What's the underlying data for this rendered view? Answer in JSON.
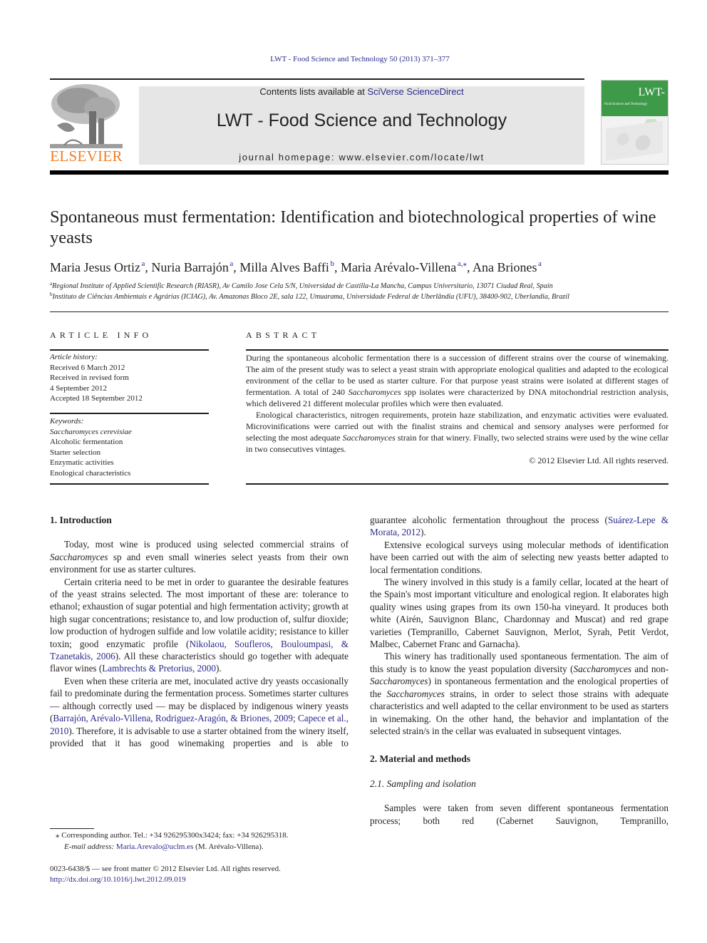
{
  "header": {
    "running_head": "LWT - Food Science and Technology 50 (2013) 371–377",
    "publisher_logo_text": "ELSEVIER",
    "contents_prefix": "Contents lists available at ",
    "contents_link": "SciVerse ScienceDirect",
    "journal_name": "LWT - Food Science and Technology",
    "homepage": "journal homepage: www.elsevier.com/locate/lwt",
    "cover": {
      "title": "LWT-",
      "subtitle": "Food Science and Technology"
    }
  },
  "article": {
    "title": "Spontaneous must fermentation: Identification and biotechnological properties of wine yeasts",
    "authors": [
      {
        "name": "Maria Jesus Ortiz",
        "sup": "a"
      },
      {
        "name": "Nuria Barrajón",
        "sup": "a"
      },
      {
        "name": "Milla Alves Baffi",
        "sup": "b"
      },
      {
        "name": "Maria Arévalo-Villena",
        "sup": "a,⁎"
      },
      {
        "name": "Ana Briones",
        "sup": "a"
      }
    ],
    "affiliations": [
      {
        "sup": "a",
        "text": "Regional Institute of Applied Scientific Research (RIASR), Av Camilo Jose Cela S/N, Universidad de Castilla-La Mancha, Campus Universitario, 13071 Ciudad Real, Spain"
      },
      {
        "sup": "b",
        "text": "Instituto de Ciências Ambientais e Agrárias (ICIAG), Av. Amazonas Bloco 2E, sala 122, Umuarama, Universidade Federal de Uberlândia (UFU), 38400-902, Uberlandia, Brazil"
      }
    ]
  },
  "article_info": {
    "heading": "ARTICLE INFO",
    "history_label": "Article history:",
    "history": [
      "Received 6 March 2012",
      "Received in revised form",
      "4 September 2012",
      "Accepted 18 September 2012"
    ],
    "keywords_label": "Keywords:",
    "keywords": [
      "Saccharomyces cerevisiae",
      "Alcoholic fermentation",
      "Starter selection",
      "Enzymatic activities",
      "Enological characteristics"
    ]
  },
  "abstract": {
    "heading": "ABSTRACT",
    "p1_a": "During the spontaneous alcoholic fermentation there is a succession of different strains over the course of winemaking. The aim of the present study was to select a yeast strain with appropriate enological qualities and adapted to the ecological environment of the cellar to be used as starter culture. For that purpose yeast strains were isolated at different stages of fermentation. A total of 240 ",
    "p1_i": "Saccharomyces",
    "p1_b": " spp isolates were characterized by DNA mitochondrial restriction analysis, which delivered 21 different molecular profiles which were then evaluated.",
    "p2_a": "Enological characteristics, nitrogen requirements, protein haze stabilization, and enzymatic activities were evaluated. Microvinifications were carried out with the finalist strains and chemical and sensory analyses were performed for selecting the most adequate ",
    "p2_i": "Saccharomyces",
    "p2_b": " strain for that winery. Finally, two selected strains were used by the wine cellar in two consecutives vintages.",
    "copyright": "© 2012 Elsevier Ltd. All rights reserved."
  },
  "body": {
    "intro_heading": "1.  Introduction",
    "intro_p1_a": "Today, most wine is produced using selected commercial strains of ",
    "intro_p1_i": "Saccharomyces",
    "intro_p1_b": " sp and even small wineries select yeasts from their own environment for use as starter cultures.",
    "intro_p2_a": "Certain criteria need to be met in order to guarantee the desirable features of the yeast strains selected. The most important of these are: tolerance to ethanol; exhaustion of sugar potential and high fermentation activity; growth at high sugar concentrations; resistance to, and low production of, sulfur dioxide; low production of hydrogen sulfide and low volatile acidity; resistance to killer toxin; good enzymatic profile (",
    "intro_p2_ref1": "Nikolaou, Soufleros, Bouloumpasi, & Tzanetakis, 2006",
    "intro_p2_b": "). All these characteristics should go together with adequate flavor wines (",
    "intro_p2_ref2": "Lambrechts & Pretorius, 2000",
    "intro_p2_c": ").",
    "intro_p3_a": "Even when these criteria are met, inoculated active dry yeasts occasionally fail to predominate during the fermentation process. Sometimes starter cultures — although correctly used — may be displaced by indigenous winery yeasts (",
    "intro_p3_ref1": "Barrajón, Arévalo-Villena, Rodriguez-Aragón, & Briones, 2009",
    "intro_p3_sep": "; ",
    "intro_p3_ref2": "Capece et al., 2010",
    "intro_p3_b": "). Therefore, it is advisable to use a starter obtained from the winery itself, provided that it has good winemaking properties and is able to",
    "right_p0_a": "guarantee alcoholic fermentation throughout the process (",
    "right_p0_ref": "Suárez-Lepe & Morata, 2012",
    "right_p0_b": ").",
    "right_p1": "Extensive ecological surveys using molecular methods of identification have been carried out with the aim of selecting new yeasts better adapted to local fermentation conditions.",
    "right_p2": "The winery involved in this study is a family cellar, located at the heart of the Spain's most important viticulture and enological region. It elaborates high quality wines using grapes from its own 150-ha vineyard. It produces both white (Airén, Sauvignon Blanc, Chardonnay and Muscat) and red grape varieties (Tempranillo, Cabernet Sauvignon, Merlot, Syrah, Petit Verdot, Malbec, Cabernet Franc and Garnacha).",
    "right_p3_a": "This winery has traditionally used spontaneous fermentation. The aim of this study is to know the yeast population diversity (",
    "right_p3_i1": "Saccharomyces",
    "right_p3_b": " and non-",
    "right_p3_i2": "Saccharomyces",
    "right_p3_c": ") in spontaneous fermentation and the enological properties of the ",
    "right_p3_i3": "Saccharomyces",
    "right_p3_d": " strains, in order to select those strains with adequate characteristics and well adapted to the cellar environment to be used as starters in winemaking. On the other hand, the behavior and implantation of the selected strain/s in the cellar was evaluated in subsequent vintages.",
    "methods_heading": "2.  Material and methods",
    "sub_heading": "2.1.  Sampling and isolation",
    "methods_p1": "Samples were taken from seven different spontaneous fermentation process; both red (Cabernet Sauvignon, Tempranillo,"
  },
  "footnotes": {
    "corresponding": "⁎  Corresponding author. Tel.: +34 926295300x3424; fax: +34 926295318.",
    "email_label": "E-mail address: ",
    "email": "Maria.Arevalo@uclm.es",
    "email_suffix": " (M. Arévalo-Villena).",
    "issn": "0023-6438/$ — see front matter © 2012 Elsevier Ltd. All rights reserved.",
    "doi": "http://dx.doi.org/10.1016/j.lwt.2012.09.019"
  }
}
